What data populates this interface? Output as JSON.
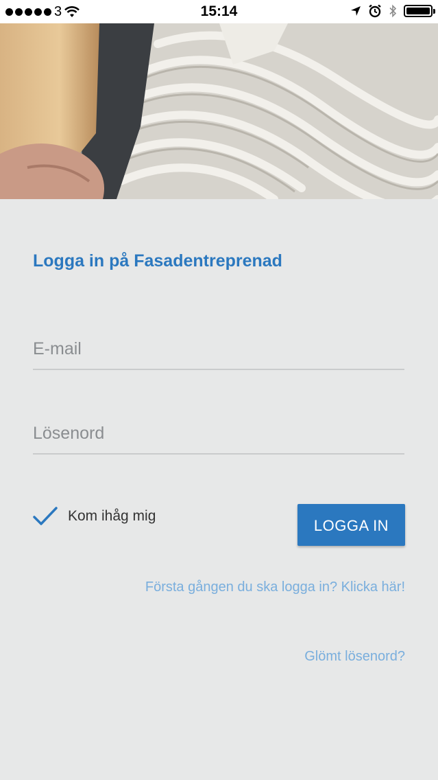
{
  "status_bar": {
    "carrier": "3",
    "time": "15:14"
  },
  "hero": {
    "description_icon": "trowel-plaster-photo"
  },
  "login": {
    "title": "Logga in på Fasadentreprenad",
    "email_placeholder": "E-mail",
    "password_placeholder": "Lösenord",
    "remember_label": "Kom ihåg mig",
    "remember_checked": true,
    "login_button": "LOGGA IN",
    "first_time_link": "Första gången du ska logga in? Klicka här!",
    "forgot_link": "Glömt lösenord?"
  },
  "colors": {
    "accent": "#2b78bf",
    "link": "#79aedd",
    "background": "#e7e8e8"
  }
}
